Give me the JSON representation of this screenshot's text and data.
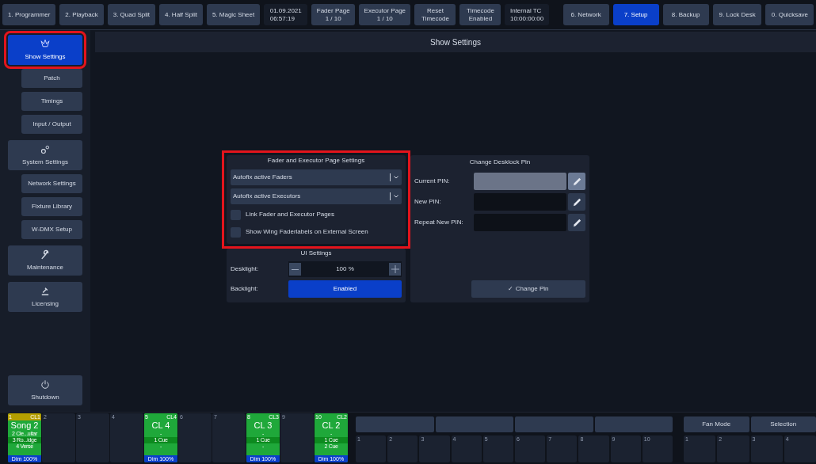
{
  "top_bar": {
    "left": [
      {
        "kind": "view",
        "lines": [
          "1. Programmer"
        ]
      },
      {
        "kind": "view",
        "lines": [
          "2. Playback"
        ]
      },
      {
        "kind": "view",
        "lines": [
          "3. Quad Split"
        ]
      },
      {
        "kind": "view",
        "lines": [
          "4. Half Split"
        ]
      },
      {
        "kind": "view",
        "lines": [
          "5. Magic Sheet"
        ]
      },
      {
        "kind": "info",
        "lines": [
          "01.09.2021",
          "06:57:19"
        ]
      },
      {
        "kind": "view",
        "lines": [
          "Fader Page",
          "1 / 10"
        ]
      },
      {
        "kind": "view",
        "lines": [
          "Executor Page",
          "1 / 10"
        ]
      },
      {
        "kind": "view",
        "lines": [
          "Reset",
          "Timecode"
        ]
      },
      {
        "kind": "view",
        "lines": [
          "Timecode",
          "Enabled"
        ]
      },
      {
        "kind": "info",
        "lines": [
          "Internal TC",
          "10:00:00:00"
        ]
      }
    ],
    "right": [
      {
        "label": "6. Network",
        "selected": false
      },
      {
        "label": "7. Setup",
        "selected": true
      },
      {
        "label": "8. Backup",
        "selected": false
      },
      {
        "label": "9. Lock Desk",
        "selected": false
      },
      {
        "label": "0. Quicksave",
        "selected": false
      }
    ]
  },
  "sidebar": {
    "items": [
      {
        "kind": "main",
        "label": "Show Settings",
        "selected": true,
        "highlighted": true
      },
      {
        "kind": "sub",
        "label": "Patch",
        "selected": false,
        "highlighted": false
      },
      {
        "kind": "sub",
        "label": "Timings",
        "selected": false,
        "highlighted": false
      },
      {
        "kind": "sub",
        "label": "Input / Output",
        "selected": false,
        "highlighted": false
      },
      {
        "kind": "main",
        "label": "System Settings",
        "selected": false,
        "highlighted": false
      },
      {
        "kind": "sub",
        "label": "Network Settings",
        "selected": false,
        "highlighted": false
      },
      {
        "kind": "sub",
        "label": "Fixture Library",
        "selected": false,
        "highlighted": false
      },
      {
        "kind": "sub",
        "label": "W-DMX Setup",
        "selected": false,
        "highlighted": false
      },
      {
        "kind": "main",
        "label": "Maintenance",
        "selected": false,
        "highlighted": false
      },
      {
        "kind": "main",
        "label": "Licensing",
        "selected": false,
        "highlighted": false
      }
    ],
    "bottom": {
      "label": "Shutdown"
    }
  },
  "main": {
    "title": "Show Settings",
    "page_settings": {
      "title": "Fader and Executor Page Settings",
      "highlighted": true,
      "dropdowns": [
        "Autofix active Faders",
        "Autofix active Executors"
      ],
      "checkboxes": [
        {
          "label": "Link Fader and Executor Pages",
          "checked": false
        },
        {
          "label": "Show Wing Faderlabels on External Screen",
          "checked": false
        }
      ]
    },
    "ui_settings": {
      "title": "UI Settings",
      "desklight": {
        "label": "Desklight:",
        "value": "100 %"
      },
      "backlight": {
        "label": "Backlight:",
        "value": "Enabled",
        "on": true
      }
    },
    "desklock": {
      "title": "Change Desklock Pin",
      "fields": [
        {
          "label": "Current PIN:",
          "disabled": true
        },
        {
          "label": "New PIN:",
          "disabled": false
        },
        {
          "label": "Repeat New PIN:",
          "disabled": false
        }
      ],
      "button": "✓ Change Pin"
    }
  },
  "faders": [
    {
      "kind": "playback",
      "number": "1",
      "tag": "CL1",
      "color": "#b59f00",
      "name": "Song 2",
      "lines": [
        "2 Cle...uitar",
        "3 Ro...idge",
        "4 Verse"
      ],
      "dim": "Dim 100%"
    },
    {
      "kind": "empty",
      "number": "2"
    },
    {
      "kind": "empty",
      "number": "3"
    },
    {
      "kind": "empty",
      "number": "4"
    },
    {
      "kind": "playback",
      "number": "5",
      "tag": "CL4",
      "color": "#1fa83a",
      "name": "CL 4",
      "lines": [
        "-",
        "1 Cue",
        "-"
      ],
      "dim": "Dim 100%"
    },
    {
      "kind": "empty",
      "number": "6"
    },
    {
      "kind": "empty",
      "number": "7"
    },
    {
      "kind": "playback",
      "number": "8",
      "tag": "CL3",
      "color": "#1fa83a",
      "name": "CL 3",
      "lines": [
        "-",
        "1 Cue",
        "-"
      ],
      "dim": "Dim 100%"
    },
    {
      "kind": "empty",
      "number": "9"
    },
    {
      "kind": "playback",
      "number": "10",
      "tag": "CL2",
      "color": "#1fa83a",
      "name": "CL 2",
      "lines": [
        "-",
        "1 Cue",
        "2 Cue"
      ],
      "dim": "Dim 100%"
    }
  ],
  "executors": {
    "keys": [
      "1",
      "2",
      "3",
      "4",
      "5",
      "6",
      "7",
      "8",
      "9",
      "10"
    ]
  },
  "wing": {
    "buttons": [
      "Fan Mode",
      "Selection"
    ],
    "keys": [
      "1",
      "2",
      "3",
      "4"
    ]
  }
}
